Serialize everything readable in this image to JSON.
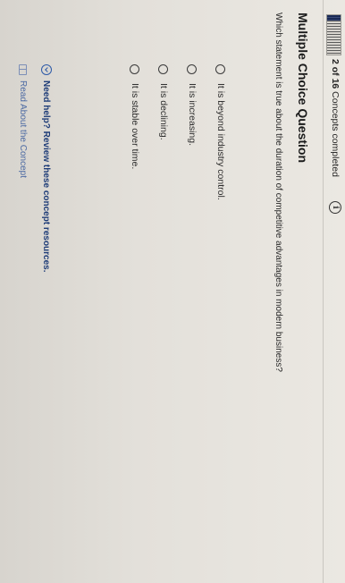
{
  "progress": {
    "text_bold": "2 of 16",
    "text_rest": " Concepts completed",
    "fraction": 0.125
  },
  "question": {
    "title": "Multiple Choice Question",
    "text": "Which statement is true about the duration of competitive advantages in modern business?",
    "options": [
      "It is beyond industry control.",
      "It is increasing.",
      "It is declining.",
      "It is stable over time."
    ]
  },
  "help": {
    "label": "Need help? Review these concept resources."
  },
  "read_concept": {
    "label": "Read About the Concept"
  },
  "colors": {
    "accent": "#1f3d78",
    "link": "#4d6aa3"
  },
  "icons": {
    "info": "info-icon",
    "help": "chevron-down-icon",
    "read": "book-icon"
  }
}
